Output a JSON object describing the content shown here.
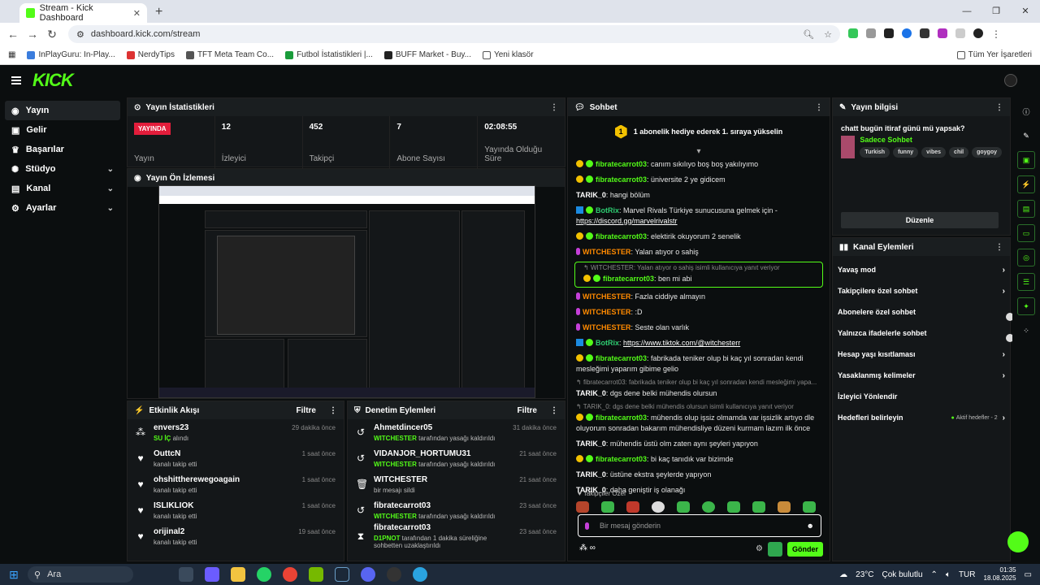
{
  "browser": {
    "tab_title": "Stream - Kick Dashboard",
    "url": "dashboard.kick.com/stream",
    "bookmarks": [
      "InPlayGuru: In-Play...",
      "NerdyTips",
      "TFT Meta Team Co...",
      "Futbol İstatistikleri |...",
      "BUFF Market - Buy...",
      "Yeni klasör"
    ],
    "all_bookmarks": "Tüm Yer İşaretleri"
  },
  "app": {
    "logo": "KICK"
  },
  "sidebar": {
    "items": [
      {
        "label": "Yayın",
        "icon": "broadcast-icon",
        "active": true
      },
      {
        "label": "Gelir",
        "icon": "revenue-icon"
      },
      {
        "label": "Başarılar",
        "icon": "trophy-icon"
      },
      {
        "label": "Stüdyo",
        "icon": "studio-icon",
        "chevron": true
      },
      {
        "label": "Kanal",
        "icon": "channel-icon",
        "chevron": true
      },
      {
        "label": "Ayarlar",
        "icon": "settings-icon",
        "chevron": true
      }
    ]
  },
  "stats": {
    "title": "Yayın İstatistikleri",
    "live_badge": "YAYINDA",
    "live_label": "Yayın",
    "viewers": {
      "value": "12",
      "label": "İzleyici"
    },
    "followers": {
      "value": "452",
      "label": "Takipçi"
    },
    "subs": {
      "value": "7",
      "label": "Abone Sayısı"
    },
    "duration": {
      "value": "02:08:55",
      "label": "Yayında Olduğu Süre"
    }
  },
  "preview": {
    "title": "Yayın Ön İzlemesi"
  },
  "activity": {
    "title": "Etkinlik Akışı",
    "filter": "Filtre",
    "items": [
      {
        "name": "envers23",
        "sub_hl": "SU İÇ",
        "sub": " alındı",
        "time": "29 dakika önce"
      },
      {
        "name": "OuttcN",
        "sub_hl": "",
        "sub": "kanalı takip etti",
        "time": "1 saat önce"
      },
      {
        "name": "ohshittherewegoagain",
        "sub_hl": "",
        "sub": "kanalı takip etti",
        "time": "1 saat önce"
      },
      {
        "name": "ISLIKLIOK",
        "sub_hl": "",
        "sub": "kanalı takip etti",
        "time": "1 saat önce"
      },
      {
        "name": "orijinal2",
        "sub_hl": "",
        "sub": "kanalı takip etti",
        "time": "19 saat önce"
      }
    ]
  },
  "moderation": {
    "title": "Denetim Eylemleri",
    "filter": "Filtre",
    "items": [
      {
        "name": "Ahmetdincer05",
        "actor": "WITCHESTER",
        "sub": " tarafından yasağı kaldırıldı",
        "time": "31 dakika önce"
      },
      {
        "name": "VIDANJOR_HORTUMU31",
        "actor": "WITCHESTER",
        "sub": " tarafından yasağı kaldırıldı",
        "time": "21 saat önce"
      },
      {
        "name": "WITCHESTER",
        "actor": "",
        "sub": "bir mesajı sildi",
        "time": "21 saat önce"
      },
      {
        "name": "fibratecarrot03",
        "actor": "WITCHESTER",
        "sub": " tarafından yasağı kaldırıldı",
        "time": "23 saat önce"
      },
      {
        "name": "fibratecarrot03",
        "actor": "D1PNOT",
        "sub": " tarafından 1 dakika süreliğine sohbetten uzaklaştırıldı",
        "time": "23 saat önce"
      }
    ]
  },
  "chat": {
    "title": "Sohbet",
    "coin_num": "1",
    "banner": "1 abonelik hediye ederek 1. sıraya yükselin",
    "messages": [
      {
        "user": "fibratecarrot03",
        "text": ": canım sıkılıyo boş boş yakılıyımo",
        "badge": "coin"
      },
      {
        "user": "fibratecarrot03",
        "text": ": üniversite 2 ye gidicem",
        "badge": "coin"
      },
      {
        "user": "TARIK_0",
        "text": ": hangi bölüm",
        "badge": "none"
      },
      {
        "user": "BotRix",
        "text": ": Marvel Rivals Türkiye sunucusuna gelmek için - ",
        "link": "https://discord.gg/marvelrivalstr",
        "badge": "bot"
      },
      {
        "user": "fibratecarrot03",
        "text": ": elektirik okuyorum 2 senelik",
        "badge": "coin"
      },
      {
        "user": "WITCHESTER",
        "text": ": Yalan atıyor o sahiş",
        "badge": "mic"
      }
    ],
    "reply1": {
      "hint": "WITCHESTER: Yalan atıyor o sahiş isimli kullanıcıya yanıt veriyor",
      "user": "fibratecarrot03",
      "text": ": ben mi abi"
    },
    "messages2": [
      {
        "user": "WITCHESTER",
        "text": ": Fazla ciddiye almayın",
        "badge": "mic"
      },
      {
        "user": "WITCHESTER",
        "text": ": :D",
        "badge": "mic"
      },
      {
        "user": "WITCHESTER",
        "text": ": Seste olan varlık",
        "badge": "mic"
      },
      {
        "user": "BotRix",
        "text": ": ",
        "link": "https://www.tiktok.com/@witchesterr",
        "badge": "bot"
      },
      {
        "user": "fibratecarrot03",
        "text": ": fabrikada teniker olup bi kaç yıl sonradan kendi mesleğimi yaparım gibime gelio",
        "badge": "coin"
      }
    ],
    "reply2": {
      "hint": "fibratecarrot03: fabrikada teniker olup bi kaç yıl sonradan kendi mesleğimi yapa...",
      "user": "TARIK_0",
      "text": ": dgs dene belki mühendis olursun"
    },
    "reply3": {
      "hint": "TARIK_0: dgs dene belki mühendis olursun isimli kullanıcıya yanıt veriyor",
      "user": "fibratecarrot03",
      "text": ": mühendis olup işsiz olmamda var işsizlik artıyo dle oluyorum sonradan bakarım mühendisliye düzeni kurmam lazım ilk önce"
    },
    "messages3": [
      {
        "user": "TARIK_0",
        "text": ": mühendis üstü olm zaten aynı şeyleri yapıyon",
        "badge": "none"
      },
      {
        "user": "fibratecarrot03",
        "text": ": bi kaç tanıdık var bizimde",
        "badge": "coin"
      },
      {
        "user": "TARIK_0",
        "text": ": üstüne ekstra şeylerde yapıyon",
        "badge": "none"
      },
      {
        "user": "TARIK_0",
        "text": ": daha geniştir iş olanağı",
        "badge": "none"
      }
    ],
    "followers_only": "Takipçiler Özel",
    "input_placeholder": "Bir mesaj gönderin",
    "send": "Gönder",
    "infinity": "∞"
  },
  "info": {
    "title": "Yayın bilgisi",
    "stream_title": "chatt bugün itiraf günü mü yapsak?",
    "category": "Sadece Sohbet",
    "tags": [
      "Turkish",
      "funny",
      "vibes",
      "chil",
      "goygoy"
    ],
    "edit": "Düzenle"
  },
  "channel_actions": {
    "title": "Kanal Eylemleri",
    "items": [
      {
        "label": "Yavaş mod",
        "kind": "chevron"
      },
      {
        "label": "Takipçilere özel sohbet",
        "kind": "chevron"
      },
      {
        "label": "Abonelere özel sohbet",
        "kind": "toggle"
      },
      {
        "label": "Yalnızca ifadelerle sohbet",
        "kind": "toggle"
      },
      {
        "label": "Hesap yaşı kısıtlaması",
        "kind": "chevron"
      },
      {
        "label": "Yasaklanmış kelimeler",
        "kind": "chevron"
      },
      {
        "label": "İzleyici Yönlendir",
        "kind": "none"
      },
      {
        "label": "Hedefleri belirleyin",
        "kind": "goals"
      }
    ],
    "goals_active": "Aktif hedefler - 2"
  },
  "taskbar": {
    "search": "Ara",
    "temp": "23°C",
    "weather": "Çok bulutlu",
    "lang": "TUR",
    "time": "01:35",
    "date": "18.08.2025"
  },
  "colors": {
    "accent": "#53fc18",
    "live": "#e31d3b",
    "coin": "#f2c100",
    "mic": "#c43fd8"
  }
}
